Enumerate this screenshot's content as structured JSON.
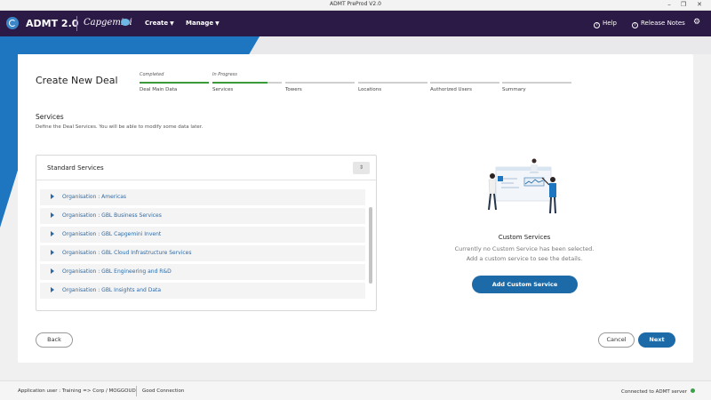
{
  "window": {
    "title": "ADMT PreProd V2.0"
  },
  "header": {
    "app_name": "ADMT 2.0",
    "brand": "Capgemini",
    "nav": [
      {
        "label": "Create"
      },
      {
        "label": "Manage"
      }
    ],
    "help_label": "Help",
    "release_notes_label": "Release Notes",
    "brand_color": "#2c1a46",
    "accent_color": "#1d76bf"
  },
  "page": {
    "title": "Create New Deal"
  },
  "stepper": {
    "steps": [
      {
        "status": "Completed",
        "name": "Deal Main Data",
        "progress": 1.0
      },
      {
        "status": "In Progress",
        "name": "Services",
        "progress": 0.8
      },
      {
        "status": "",
        "name": "Towers",
        "progress": 0
      },
      {
        "status": "",
        "name": "Locations",
        "progress": 0
      },
      {
        "status": "",
        "name": "Authorized Users",
        "progress": 0
      },
      {
        "status": "",
        "name": "Summary",
        "progress": 0
      }
    ]
  },
  "services": {
    "title": "Services",
    "description": "Define the Deal Services. You will be able to modify some data later.",
    "panel_title": "Standard Services",
    "items": [
      {
        "label": "Organisation : Americas"
      },
      {
        "label": "Organisation : GBL Business Services"
      },
      {
        "label": "Organisation : GBL Capgemini Invent"
      },
      {
        "label": "Organisation : GBL Cloud Infrastructure Services"
      },
      {
        "label": "Organisation : GBL Engineering and R&D"
      },
      {
        "label": "Organisation : GBL Insights and Data"
      }
    ]
  },
  "custom_services": {
    "title": "Custom Services",
    "line1": "Currently no Custom Service has been selected.",
    "line2": "Add a custom service to see the details.",
    "add_button": "Add Custom Service"
  },
  "actions": {
    "back": "Back",
    "cancel": "Cancel",
    "next": "Next"
  },
  "statusbar": {
    "user": "Application user : Training => Corp / MOGGOUD",
    "connection": "Good Connection",
    "server": "Connected to ADMT server",
    "status_color": "#3aa34a"
  }
}
